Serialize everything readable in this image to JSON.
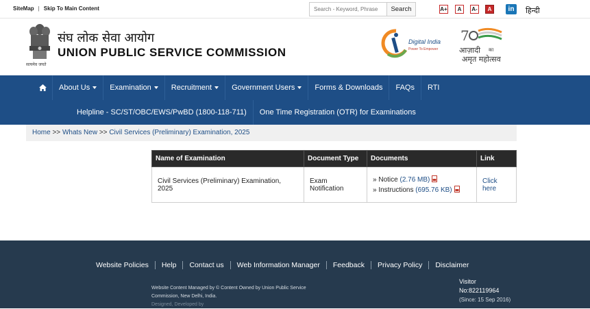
{
  "topbar": {
    "sitemap": "SiteMap",
    "separator": "|",
    "skip": "Skip To Main Content",
    "search_placeholder": "Search - Keyword, Phrase",
    "search_button": "Search",
    "font_small": "A+",
    "font_normal": "A",
    "font_large": "A-",
    "font_contrast": "A",
    "linkedin": "in",
    "language": "हिन्दी"
  },
  "header": {
    "title_hindi": "संघ लोक सेवा आयोग",
    "title_english": "UNION PUBLIC SERVICE COMMISSION",
    "emblem_caption": "सत्यमेव जयते",
    "digital_india": "Digital India",
    "digital_india_tag": "Power To Empower",
    "azadi_line1": "आज़ादी",
    "azadi_line2": "का",
    "azadi_line3": "अमृत महोत्सव"
  },
  "nav": {
    "row1": [
      "About Us",
      "Examination",
      "Recruitment",
      "Government Users",
      "Forms & Downloads",
      "FAQs",
      "RTI"
    ],
    "row2": [
      "Helpline - SC/ST/OBC/EWS/PwBD (1800-118-711)",
      "One Time Registration (OTR) for Examinations"
    ]
  },
  "breadcrumb": {
    "home": "Home",
    "sep": ">>",
    "whats_new": "Whats New",
    "current": "Civil Services (Preliminary) Examination, 2025"
  },
  "table": {
    "headers": [
      "Name of Examination",
      "Document Type",
      "Documents",
      "Link"
    ],
    "row": {
      "name": "Civil Services (Preliminary) Examination, 2025",
      "type": "Exam Notification",
      "doc1_label": "Notice",
      "doc1_size": "(2.76 MB)",
      "doc2_label": "Instructions",
      "doc2_size": "(695.76 KB)",
      "link": "Click here"
    }
  },
  "footer": {
    "links": [
      "Website Policies",
      "Help",
      "Contact us",
      "Web Information Manager",
      "Feedback",
      "Privacy Policy",
      "Disclaimer"
    ],
    "note": "Website Content Managed by © Content Owned by Union Public Service Commission, New Delhi, India.",
    "designed": "Designed, Developed by",
    "visitor_label": "Visitor",
    "visitor_no": "No:822119964",
    "since": "(Since: 15 Sep 2016)"
  },
  "colors": {
    "nav_blue": "#1e4e86",
    "footer_dark": "#263a4e",
    "table_header": "#2a2a2a",
    "font_btn_red": "#c62828"
  }
}
